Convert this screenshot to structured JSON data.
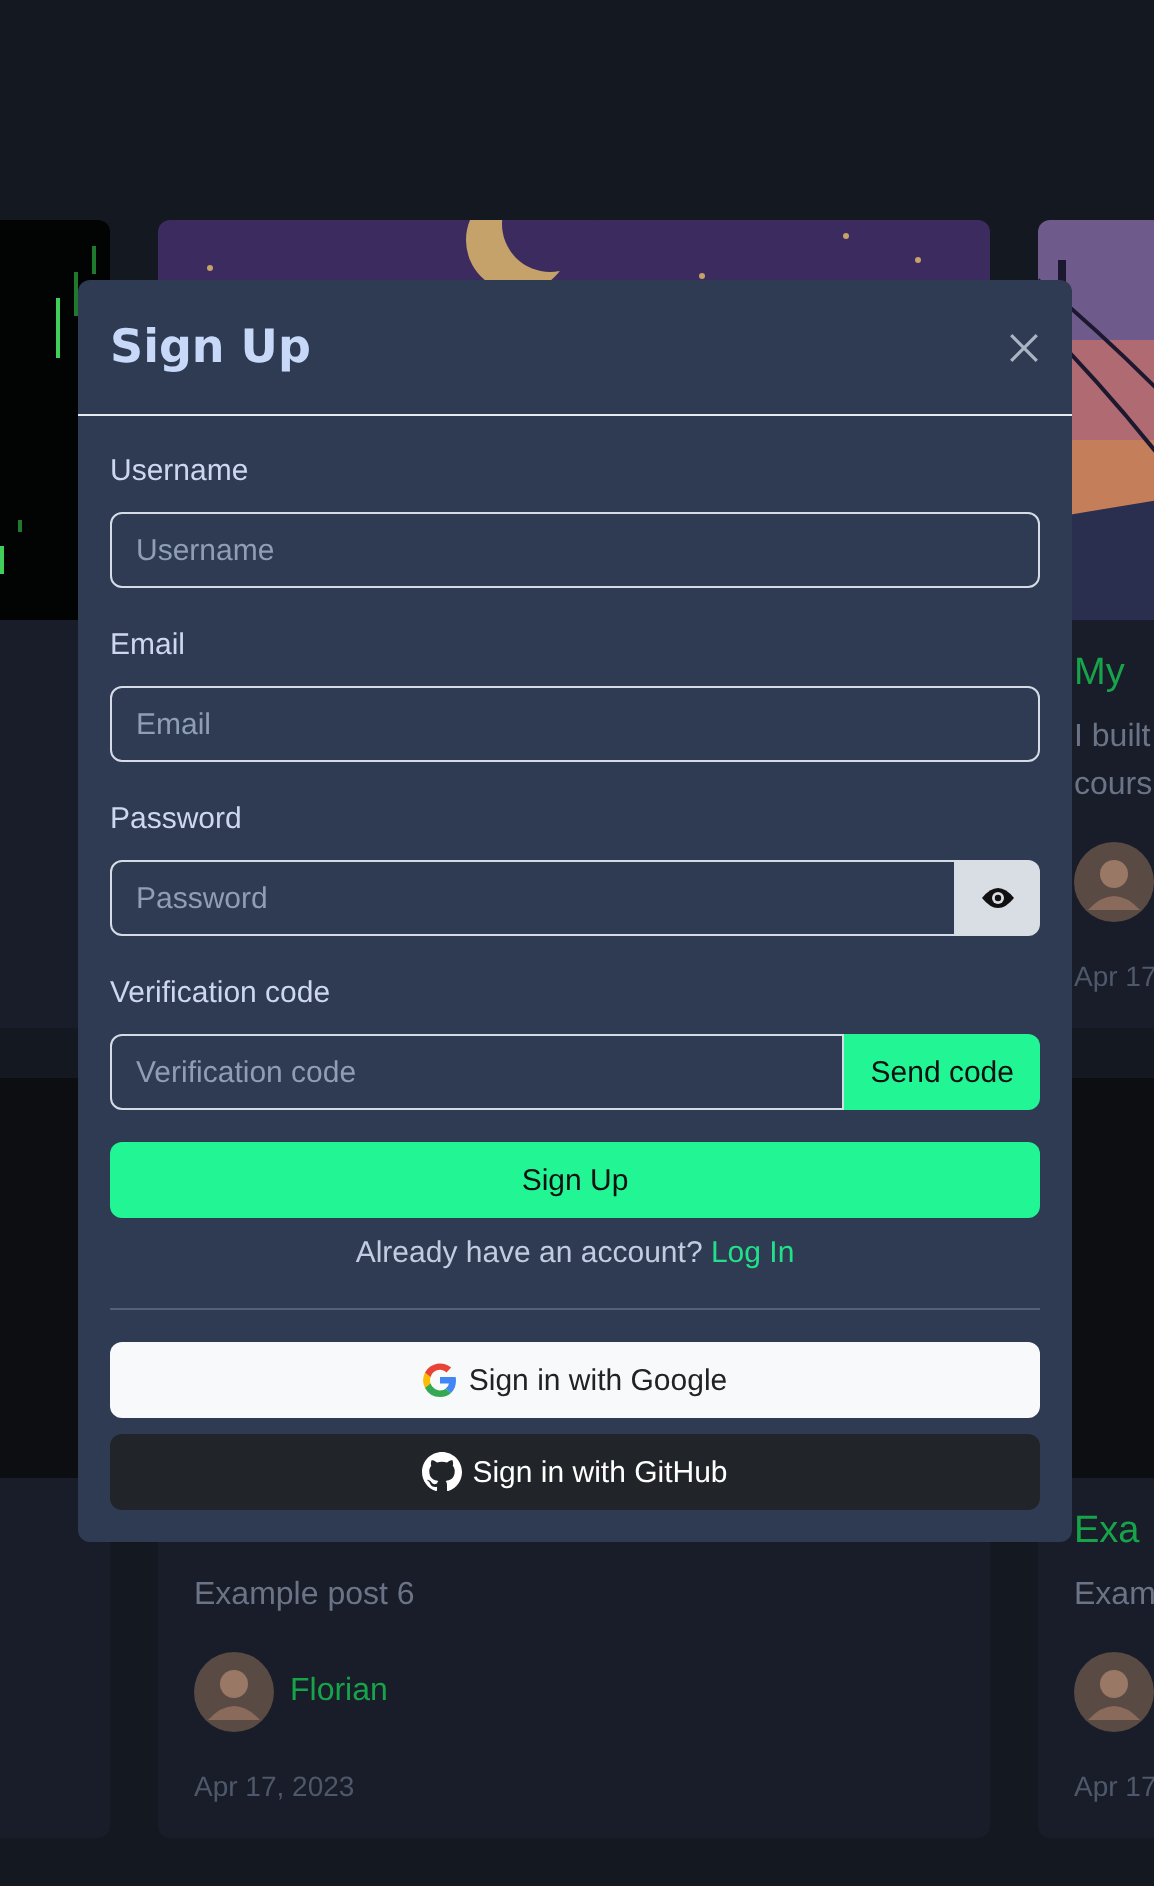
{
  "card_rows": [
    [
      {},
      {},
      {
        "title": "My",
        "excerpt": "I built cours",
        "avatar": true,
        "date": "Apr 17"
      }
    ],
    [
      {},
      {
        "excerpt": "Example post 6",
        "avatar": true,
        "author": "Florian",
        "date": "Apr 17, 2023"
      },
      {
        "title": "Exa",
        "excerpt": "Exam",
        "avatar": true,
        "date": "Apr 17"
      }
    ]
  ],
  "dialog": {
    "title": "Sign Up",
    "fields": [
      {
        "label": "Username",
        "placeholder": "Username",
        "kind": "text"
      },
      {
        "label": "Email",
        "placeholder": "Email",
        "kind": "text"
      },
      {
        "label": "Password",
        "placeholder": "Password",
        "kind": "password"
      },
      {
        "label": "Verification code",
        "placeholder": "Verification code",
        "kind": "code",
        "action": "Send code"
      }
    ],
    "submit": "Sign Up",
    "login_prompt": "Already have an account?",
    "login_link": "Log In",
    "providers": [
      {
        "kind": "google",
        "label": "Sign in with Google"
      },
      {
        "kind": "github",
        "label": "Sign in with GitHub"
      }
    ]
  }
}
